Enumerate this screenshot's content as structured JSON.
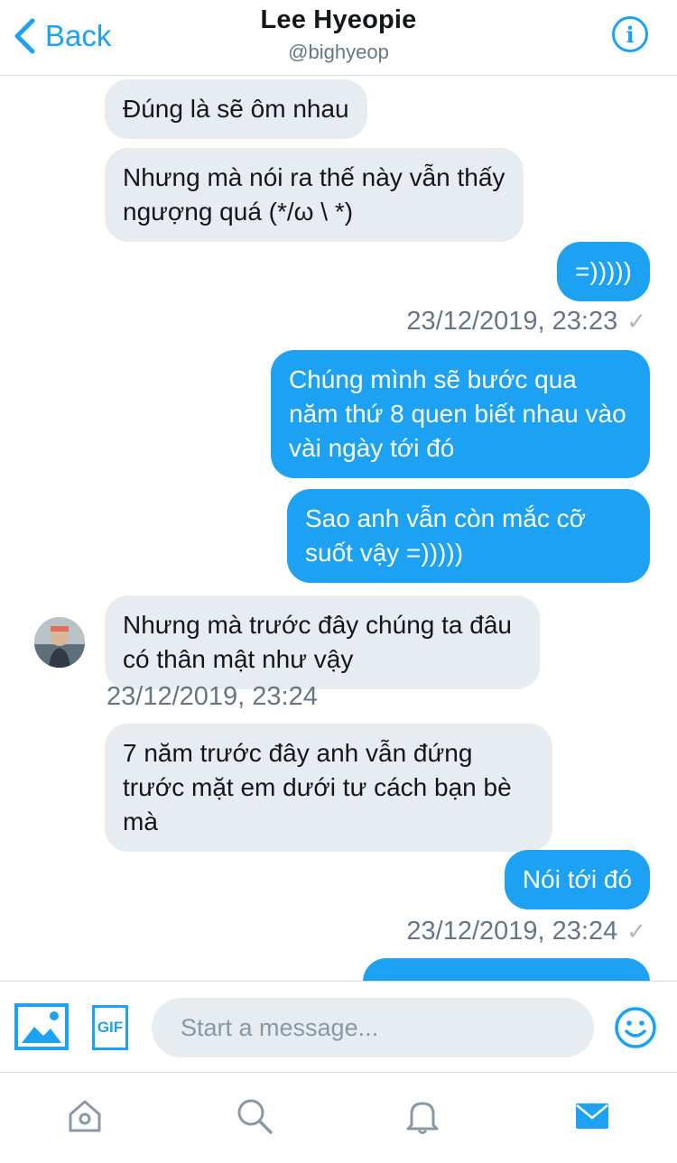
{
  "header": {
    "back_label": "Back",
    "title": "Lee Hyeopie",
    "handle": "@bighyeop",
    "info_icon": "info-icon"
  },
  "messages": [
    {
      "direction": "in",
      "text": "Đúng là sẽ ôm nhau"
    },
    {
      "direction": "in",
      "text": "Nhưng mà nói ra thế này vẫn thấy ngượng quá (*/ω \\ *)"
    },
    {
      "direction": "out",
      "text": "=)))))"
    },
    {
      "direction": "out",
      "timestamp": "23/12/2019, 23:23",
      "check_icon": "check-icon"
    },
    {
      "direction": "out",
      "text": "Chúng mình sẽ bước qua năm thứ 8 quen biết nhau vào vài ngày tới đó"
    },
    {
      "direction": "out",
      "text": "Sao anh vẫn còn mắc cỡ suốt vậy =)))))"
    },
    {
      "direction": "in",
      "text": "Nhưng mà trước đây chúng ta đâu có thân mật như vậy"
    },
    {
      "direction": "in",
      "timestamp": "23/12/2019, 23:24"
    },
    {
      "direction": "in",
      "text": "7 năm trước đây anh vẫn đứng trước mặt em dưới tư cách bạn bè mà"
    },
    {
      "direction": "out",
      "text": "Nói tới đó"
    },
    {
      "direction": "out",
      "timestamp": "23/12/2019, 23:24",
      "check_icon": "check-icon"
    }
  ],
  "composer": {
    "placeholder": "Start a message...",
    "gif_label": "GIF",
    "icons": [
      "image-icon",
      "gif-icon",
      "emoji-icon"
    ]
  },
  "tabbar": {
    "icons": [
      "home-icon",
      "search-icon",
      "bell-icon",
      "mail-icon"
    ],
    "active": "mail-icon"
  },
  "colors": {
    "accent": "#1da1f2",
    "incoming_bubble": "#e6ecf0",
    "secondary_text": "#657786"
  }
}
